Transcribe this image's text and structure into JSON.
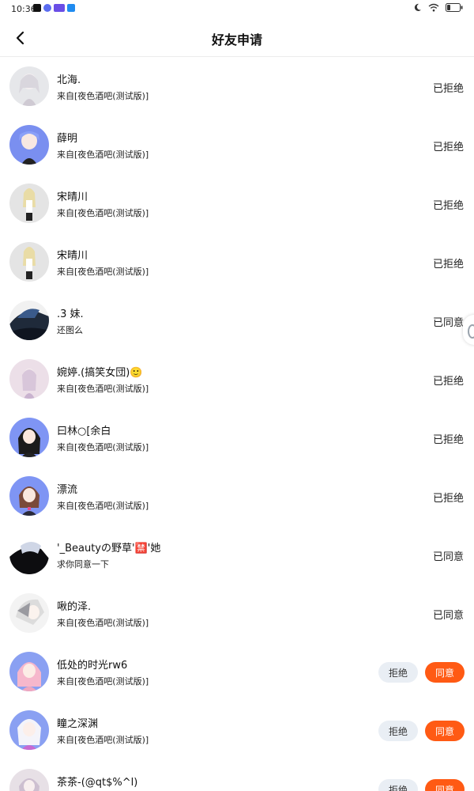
{
  "status_bar": {
    "time": "10:36"
  },
  "header": {
    "title": "好友申请"
  },
  "colors": {
    "accent": "#ff5a14",
    "reject_bg": "#e9eef4"
  },
  "requests": [
    {
      "name": "北海.",
      "source": "来自[夜色酒吧(测试版)]",
      "status": "已拒绝"
    },
    {
      "name": "薛明",
      "source": "来自[夜色酒吧(测试版)]",
      "status": "已拒绝"
    },
    {
      "name": "宋晴川",
      "source": "来自[夜色酒吧(测试版)]",
      "status": "已拒绝"
    },
    {
      "name": "宋晴川",
      "source": "来自[夜色酒吧(测试版)]",
      "status": "已拒绝"
    },
    {
      "name": ".3 妹.",
      "source": "还图么",
      "status": "已同意"
    },
    {
      "name": "婉婷.(搞笑女団)🙂",
      "source": "来自[夜色酒吧(测试版)]",
      "status": "已拒绝"
    },
    {
      "name": "曰林○[余白",
      "source": "来自[夜色酒吧(测试版)]",
      "status": "已拒绝"
    },
    {
      "name": "漂流",
      "source": "来自[夜色酒吧(测试版)]",
      "status": "已拒绝"
    },
    {
      "name": "'_Beautyの野草'🈲'她",
      "source": "求你同意一下",
      "status": "已同意"
    },
    {
      "name": "啾的泽.",
      "source": "来自[夜色酒吧(测试版)]",
      "status": "已同意"
    },
    {
      "name": "低处的时光rw6",
      "source": "来自[夜色酒吧(测试版)]",
      "reject_label": "拒绝",
      "accept_label": "同意"
    },
    {
      "name": "瞳之深渊",
      "source": "来自[夜色酒吧(测试版)]",
      "reject_label": "拒绝",
      "accept_label": "同意"
    },
    {
      "name": "茶茶-(@qt$%^l)",
      "source": "",
      "reject_label": "拒绝",
      "accept_label": "同意"
    }
  ]
}
